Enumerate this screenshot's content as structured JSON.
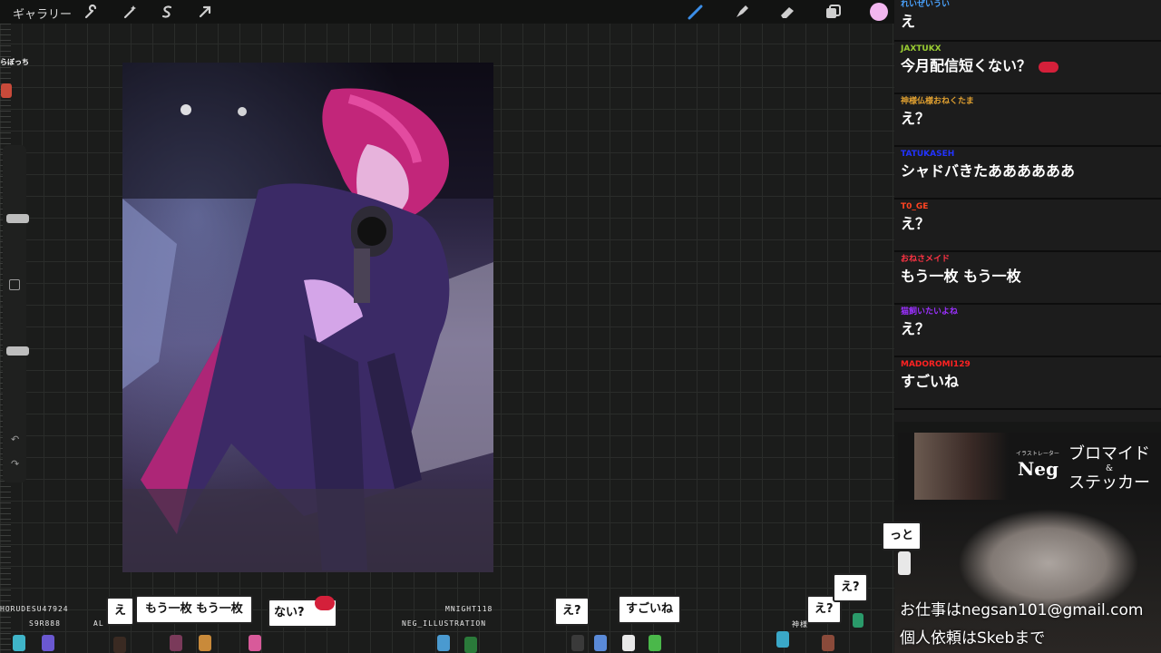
{
  "toolbar": {
    "gallery_label": "ギャラリー",
    "tools_left": [
      "wrench-icon",
      "magic-wand-icon",
      "selection-s-icon",
      "move-arrow-icon"
    ],
    "tools_right": [
      "brush-icon",
      "smudge-icon",
      "eraser-icon",
      "layers-icon"
    ],
    "current_color": "#f2b6ef"
  },
  "overlay_top_left": "らぼっち",
  "chat": [
    {
      "user": "れいぜいうい",
      "color": "#4aa3ff",
      "text": "え"
    },
    {
      "user": "JAXTUKX",
      "color": "#9acd32",
      "text": "今月配信短くない？"
    },
    {
      "user": "神様仏様おねくたま",
      "color": "#e0a030",
      "text": "え？"
    },
    {
      "user": "TATUKASEH",
      "color": "#2233ff",
      "text": "シャドバきたああああああ"
    },
    {
      "user": "T0_GE",
      "color": "#ff4422",
      "text": "え？"
    },
    {
      "user": "おねさメイド",
      "color": "#ff3344",
      "text": "もう一枚 もう一枚"
    },
    {
      "user": "猫飼いたいよね",
      "color": "#9b30ff",
      "text": "え？"
    },
    {
      "user": "MADOROMI129",
      "color": "#ff2222",
      "text": "すごいね"
    }
  ],
  "promo": {
    "subtitle": "イラストレーター",
    "name": "Neg",
    "line1": "ブロマイド",
    "amp": "&",
    "line2": "ステッカー"
  },
  "contact": {
    "line1": "お仕事はnegsan101@gmail.com",
    "line2": "個人依頼はSkebまで"
  },
  "stream_overlay": {
    "bubbles": {
      "b1": "え",
      "b2": "もう一枚 もう一枚",
      "b3": "ない?",
      "b4": "え?",
      "b5": "すごいね",
      "b6": "え?",
      "b7": "え?",
      "b8": "っと"
    },
    "names": {
      "n1": "HORUDESU47924",
      "n2": "S9R888",
      "n3": "AL",
      "n4": "MNIGHT118",
      "n5": "NEG_ILLUSTRATION",
      "n6": "神様"
    }
  }
}
